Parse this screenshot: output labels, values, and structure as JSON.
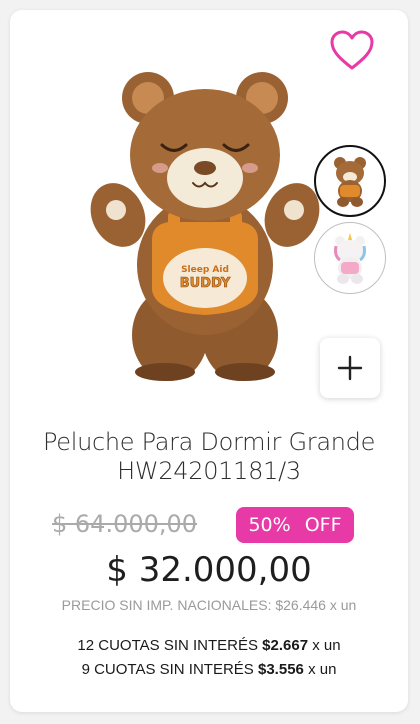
{
  "product": {
    "title_line1": "Peluche Para Dormir Grande",
    "title_line2": "HW24201181/3",
    "old_price": "$ 64.000,00",
    "discount_percent": "50%",
    "discount_label": "OFF",
    "price": "$ 32.000,00",
    "tax_note": "PRECIO SIN IMP. NACIONALES: $26.446 x un",
    "installments": [
      {
        "prefix": "12 CUOTAS SIN INTERÉS",
        "amount": "$2.667",
        "suffix": "x un"
      },
      {
        "prefix": "9 CUOTAS SIN INTERÉS",
        "amount": "$3.556",
        "suffix": "x un"
      }
    ],
    "plush_label_top": "Sleep Aid",
    "plush_label_bottom": "BUDDY"
  },
  "icons": {
    "favorite": "heart-outline-icon",
    "add": "plus-icon"
  },
  "colors": {
    "accent": "#e83aa6",
    "bear_fur": "#9a6233",
    "overalls": "#e08a2c"
  }
}
